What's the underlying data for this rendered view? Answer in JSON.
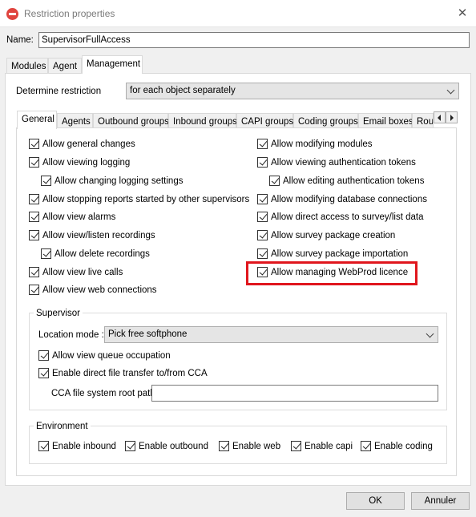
{
  "window": {
    "title": "Restriction properties",
    "close_glyph": "✕"
  },
  "name_field": {
    "label": "Name:",
    "value": "SupervisorFullAccess"
  },
  "top_tabs": [
    {
      "label": "Modules",
      "active": false
    },
    {
      "label": "Agent",
      "active": false
    },
    {
      "label": "Management",
      "active": true
    }
  ],
  "determine": {
    "label": "Determine restriction",
    "value": "for each object separately"
  },
  "sub_tabs": [
    {
      "label": "General",
      "active": true
    },
    {
      "label": "Agents",
      "active": false
    },
    {
      "label": "Outbound groups",
      "active": false
    },
    {
      "label": "Inbound groups",
      "active": false
    },
    {
      "label": "CAPI groups",
      "active": false
    },
    {
      "label": "Coding groups",
      "active": false
    },
    {
      "label": "Email boxes",
      "active": false
    },
    {
      "label": "Rou",
      "active": false
    }
  ],
  "left_checks": [
    {
      "label": "Allow general changes",
      "checked": true
    },
    {
      "label": "Allow viewing logging",
      "checked": true
    },
    {
      "label": "Allow changing logging settings",
      "checked": true
    },
    {
      "label": "Allow stopping reports started by other supervisors",
      "checked": true
    },
    {
      "label": "Allow view alarms",
      "checked": true
    },
    {
      "label": "Allow view/listen recordings",
      "checked": true
    },
    {
      "label": "Allow delete recordings",
      "checked": true
    },
    {
      "label": "Allow view live calls",
      "checked": true
    },
    {
      "label": "Allow view web connections",
      "checked": true
    }
  ],
  "right_checks": [
    {
      "label": "Allow modifying modules",
      "checked": true
    },
    {
      "label": "Allow viewing authentication tokens",
      "checked": true
    },
    {
      "label": "Allow editing authentication tokens",
      "checked": true
    },
    {
      "label": "Allow modifying database connections",
      "checked": true
    },
    {
      "label": "Allow direct access to survey/list data",
      "checked": true
    },
    {
      "label": "Allow survey package creation",
      "checked": true
    },
    {
      "label": "Allow survey package importation",
      "checked": true
    },
    {
      "label": "Allow managing WebProd licence",
      "checked": true
    }
  ],
  "supervisor": {
    "title": "Supervisor",
    "location_label": "Location mode :",
    "location_value": "Pick free softphone",
    "checks": [
      {
        "label": "Allow view queue occupation",
        "checked": true
      },
      {
        "label": "Enable direct file transfer to/from CCA",
        "checked": true
      }
    ],
    "cca_label": "CCA file system root path:",
    "cca_value": ""
  },
  "environment": {
    "title": "Environment",
    "checks": [
      {
        "label": "Enable inbound",
        "checked": true
      },
      {
        "label": "Enable outbound",
        "checked": true
      },
      {
        "label": "Enable web",
        "checked": true
      },
      {
        "label": "Enable capi",
        "checked": true
      },
      {
        "label": "Enable coding",
        "checked": true
      }
    ]
  },
  "buttons": {
    "ok": "OK",
    "cancel": "Annuler"
  },
  "colors": {
    "highlight": "#e0161d",
    "title_icon": "#e0443e"
  }
}
